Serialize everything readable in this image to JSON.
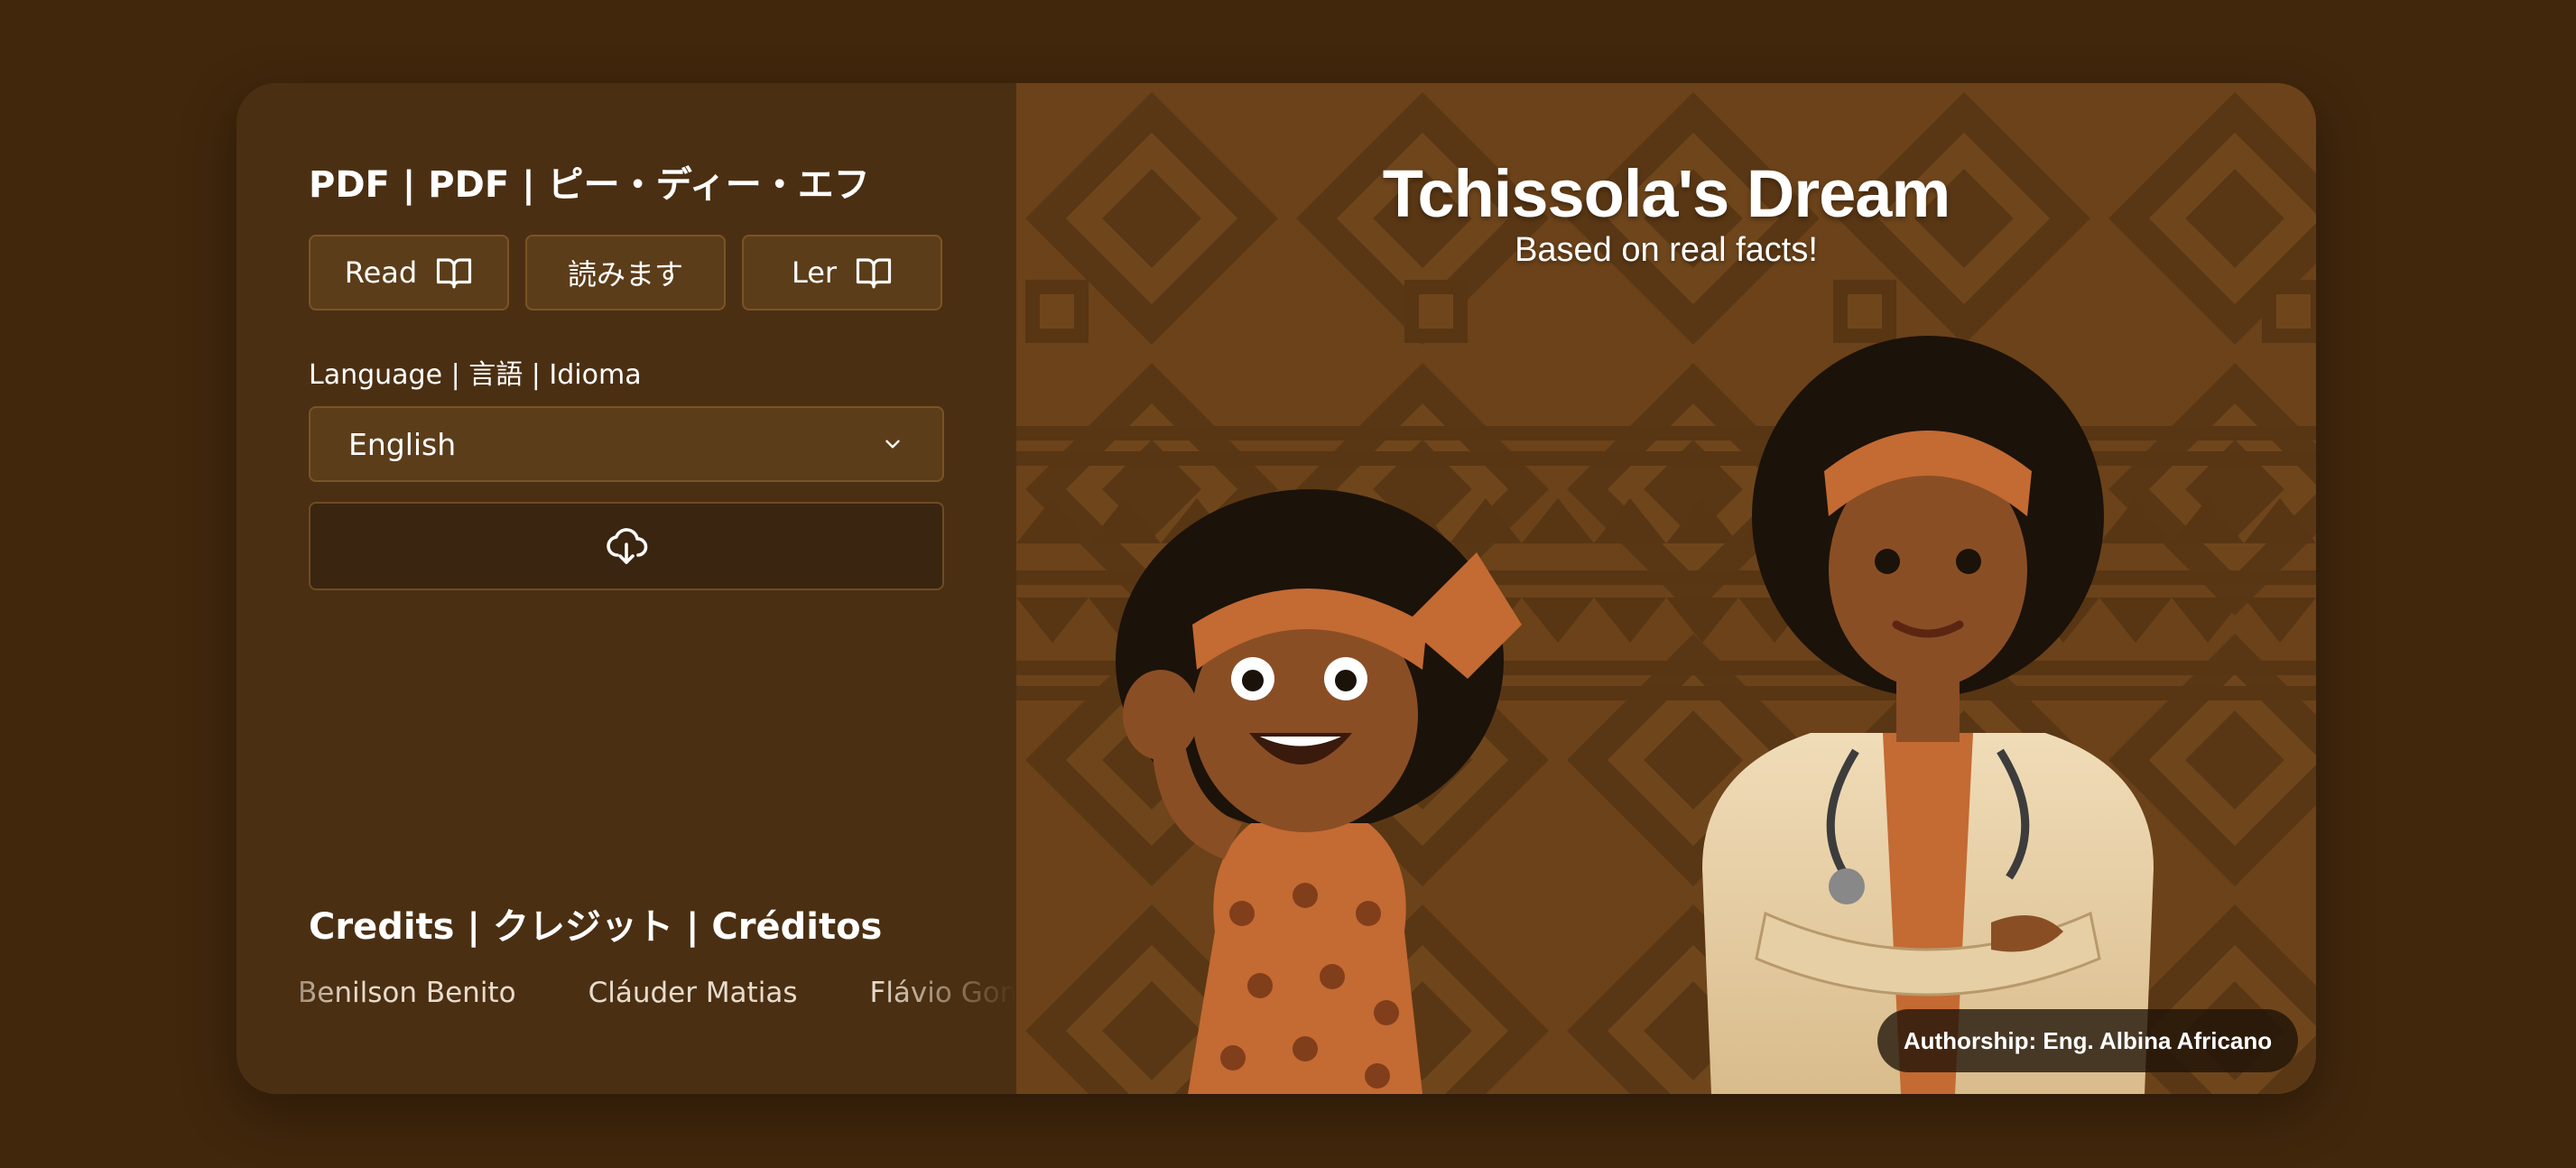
{
  "pdf_section": {
    "title": "PDF | PDF | ピー・ディー・エフ",
    "buttons": [
      {
        "label": "Read",
        "icon": "book-open-icon"
      },
      {
        "label": "読みます",
        "icon": ""
      },
      {
        "label": "Ler",
        "icon": "book-open-icon"
      }
    ]
  },
  "language": {
    "label": "Language | 言語 | Idioma",
    "selected": "English",
    "dropdown_icon": "chevron-down-icon"
  },
  "download": {
    "icon": "cloud-download-icon"
  },
  "credits": {
    "title": "Credits | クレジット | Créditos",
    "names": [
      "Benilson Benito",
      "Cláuder Matias",
      "Flávio Gon"
    ]
  },
  "cover": {
    "title": "Tchissola's Dream",
    "subtitle": "Based on real facts!",
    "authorship": "Authorship: Eng. Albina Africano"
  },
  "colors": {
    "page_bg": "#41270c",
    "panel_bg": "#4b2f12",
    "button_bg": "#5c3d19",
    "button_border": "#7a5427",
    "text": "#ffffff"
  }
}
